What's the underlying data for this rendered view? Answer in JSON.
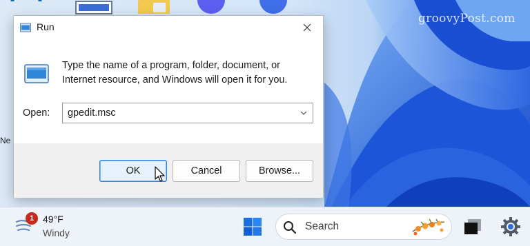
{
  "watermark": "groovyPost.com",
  "desktop": {
    "partial_label": "Ne"
  },
  "dialog": {
    "title": "Run",
    "description": "Type the name of a program, folder, document, or Internet resource, and Windows will open it for you.",
    "open_label": "Open:",
    "open_value": "gpedit.msc",
    "buttons": {
      "ok": "OK",
      "cancel": "Cancel",
      "browse": "Browse..."
    }
  },
  "taskbar": {
    "weather": {
      "badge": "1",
      "temperature": "49°F",
      "condition": "Windy"
    },
    "search_label": "Search"
  },
  "colors": {
    "accent": "#2f86d8",
    "badge": "#c42b1c",
    "wallpaper_blue": "#1f5be0"
  },
  "icons": [
    "run-app-icon",
    "close-icon",
    "chevron-down-icon",
    "pointer-cursor-icon",
    "weather-icon",
    "windows-start-icon",
    "search-icon",
    "task-view-icon",
    "settings-icon"
  ]
}
